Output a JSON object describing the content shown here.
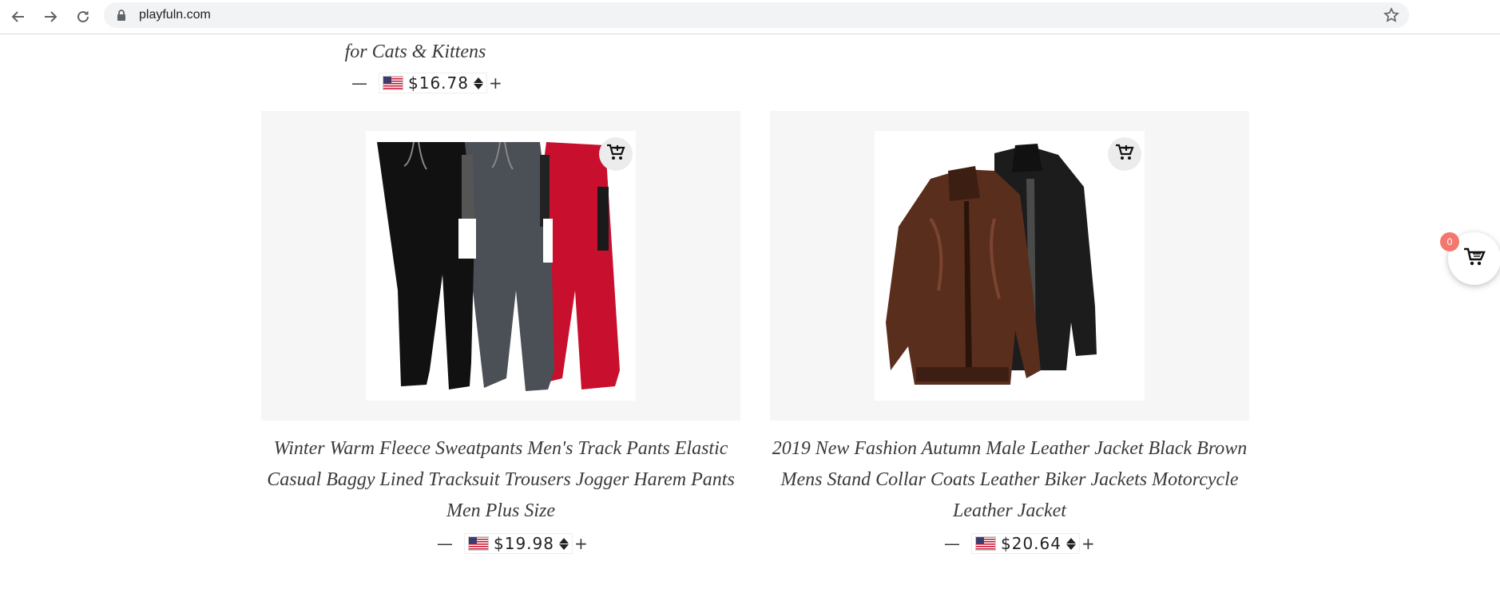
{
  "browser": {
    "url": "playfuln.com"
  },
  "top_product": {
    "title_tail": "for Cats & Kittens",
    "currency_symbol": "$",
    "price": "16.78",
    "minus": "—",
    "plus": "+"
  },
  "products": [
    {
      "title": "Winter Warm Fleece Sweatpants Men's Track Pants Elastic Casual Baggy Lined Tracksuit Trousers Jogger Harem Pants Men Plus Size",
      "currency_symbol": "$",
      "price": "19.98",
      "minus": "—",
      "plus": "+",
      "image_icon": "sweatpants-image"
    },
    {
      "title": "2019 New Fashion Autumn Male Leather Jacket Black Brown Mens Stand Collar Coats Leather Biker Jackets Motorcycle Leather Jacket",
      "currency_symbol": "$",
      "price": "20.64",
      "minus": "—",
      "plus": "+",
      "image_icon": "leather-jacket-image"
    }
  ],
  "cart": {
    "count": "0",
    "icon": "shopping-cart-icon"
  },
  "colors": {
    "card_bg": "#f6f6f6",
    "badge": "#f2776e",
    "text": "#3a3a3a"
  }
}
